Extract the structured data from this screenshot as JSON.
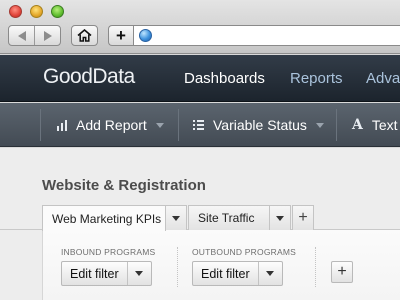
{
  "browser": {
    "back_icon": "back-arrow-icon",
    "forward_icon": "forward-arrow-icon",
    "home_icon": "home-icon",
    "new_tab_label": "+",
    "address_icon": "globe-icon"
  },
  "header": {
    "logo_good": "Good",
    "logo_data": "Data",
    "nav": [
      "Dashboards",
      "Reports",
      "Adva"
    ]
  },
  "toolbar": {
    "add_report": "Add Report",
    "variable_status": "Variable Status",
    "text": "Text"
  },
  "page": {
    "title": "Website & Registration"
  },
  "tabs": [
    {
      "label": "Web Marketing KPIs",
      "active": true
    },
    {
      "label": "Site Traffic",
      "active": false
    }
  ],
  "tab_add_label": "+",
  "filters": [
    {
      "label": "INBOUND PROGRAMS",
      "button": "Edit filter"
    },
    {
      "label": "OUTBOUND PROGRAMS",
      "button": "Edit filter"
    }
  ],
  "add_filter_label": "+",
  "colors": {
    "header_bg": "#26303a",
    "toolbar_bg": "#4f5861",
    "nav_active": "#ffffff",
    "nav_inactive": "#aac3dc"
  }
}
